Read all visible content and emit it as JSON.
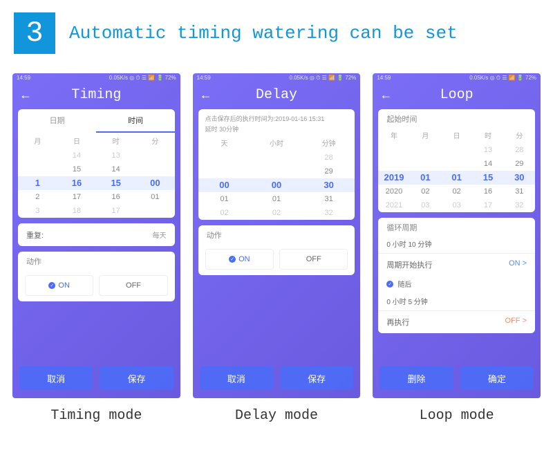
{
  "header": {
    "badge": "3",
    "title": "Automatic timing watering can be set"
  },
  "statusbar": {
    "left_time": "14:59",
    "right": "0.05K/s ◎ ⏱ ☰ 📶 🔋 72%"
  },
  "screens": {
    "timing": {
      "title": "Timing",
      "tabs": {
        "date": "日期",
        "time": "时间"
      },
      "headers": {
        "month": "月",
        "day": "日",
        "hour": "时",
        "minute": "分"
      },
      "cols": {
        "month": [
          "",
          "",
          "1",
          "2",
          "3"
        ],
        "day": [
          "14",
          "15",
          "16",
          "17",
          "18"
        ],
        "hour": [
          "13",
          "14",
          "15",
          "16",
          "17"
        ],
        "minute": [
          "",
          "",
          "00",
          "01",
          ""
        ]
      },
      "repeat": {
        "label": "重复:",
        "value": "每天"
      },
      "action_label": "动作",
      "on": "ON",
      "off": "OFF",
      "cancel": "取消",
      "save": "保存"
    },
    "delay": {
      "title": "Delay",
      "hint1": "点击保存后的执行时间为:2019-01-16 15:31",
      "hint2": "延时 30分钟",
      "headers": {
        "days": "天",
        "hours": "小时",
        "minutes": "分钟"
      },
      "cols": {
        "days": [
          "",
          "",
          "00",
          "01",
          "02"
        ],
        "hours": [
          "",
          "",
          "00",
          "01",
          "02"
        ],
        "minutes": [
          "28",
          "29",
          "30",
          "31",
          "32"
        ]
      },
      "action_label": "动作",
      "on": "ON",
      "off": "OFF",
      "cancel": "取消",
      "save": "保存"
    },
    "loop": {
      "title": "Loop",
      "start_label": "起始时间",
      "headers": {
        "year": "年",
        "month": "月",
        "day": "日",
        "hour": "时",
        "minute": "分"
      },
      "cols": {
        "year": [
          "",
          "",
          "2019",
          "2020",
          "2021"
        ],
        "month": [
          "",
          "",
          "01",
          "02",
          "03"
        ],
        "day": [
          "",
          "",
          "01",
          "02",
          "03"
        ],
        "hour": [
          "13",
          "14",
          "15",
          "16",
          "17"
        ],
        "minute": [
          "28",
          "29",
          "30",
          "31",
          "32"
        ]
      },
      "cycle": {
        "label": "循环周期",
        "value": "0 小时 10 分钟"
      },
      "startcycle": {
        "label": "周期开始执行",
        "value": "ON >"
      },
      "then": {
        "label": "随后",
        "value": "0 小时 5 分钟"
      },
      "reexec": {
        "label": "再执行",
        "value": "OFF >"
      },
      "delete": "删除",
      "ok": "确定"
    }
  },
  "captions": {
    "timing": "Timing mode",
    "delay": "Delay mode",
    "loop": "Loop mode"
  }
}
